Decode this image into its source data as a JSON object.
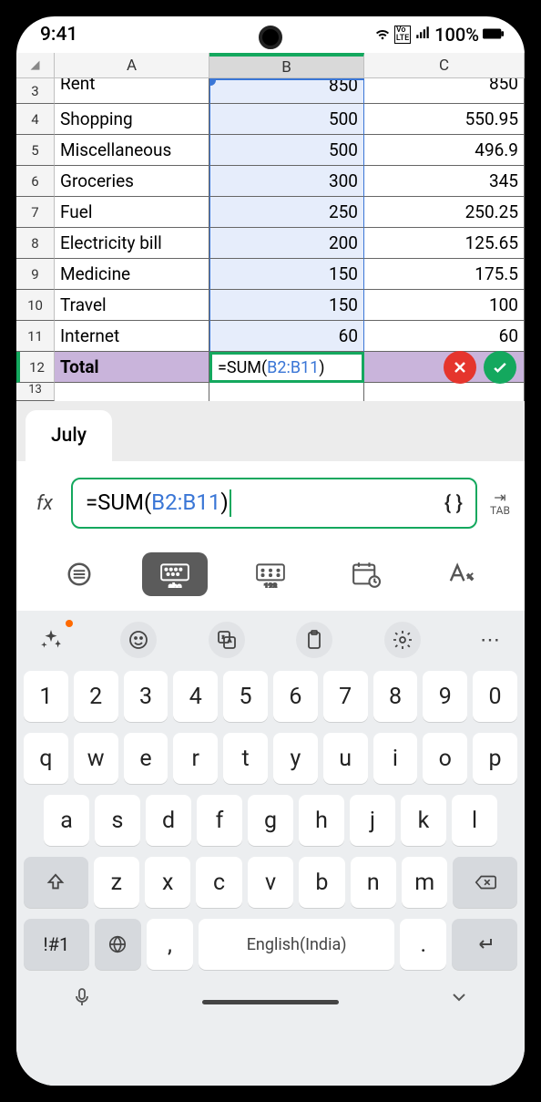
{
  "status": {
    "time": "9:41",
    "battery": "100%"
  },
  "columns": {
    "A": "A",
    "B": "B",
    "C": "C"
  },
  "rows": [
    {
      "n": "3",
      "a": "Rent",
      "b": "850",
      "c": "850"
    },
    {
      "n": "4",
      "a": "Shopping",
      "b": "500",
      "c": "550.95"
    },
    {
      "n": "5",
      "a": "Miscellaneous",
      "b": "500",
      "c": "496.9"
    },
    {
      "n": "6",
      "a": "Groceries",
      "b": "300",
      "c": "345"
    },
    {
      "n": "7",
      "a": "Fuel",
      "b": "250",
      "c": "250.25"
    },
    {
      "n": "8",
      "a": "Electricity bill",
      "b": "200",
      "c": "125.65"
    },
    {
      "n": "9",
      "a": "Medicine",
      "b": "150",
      "c": "175.5"
    },
    {
      "n": "10",
      "a": "Travel",
      "b": "150",
      "c": "100"
    },
    {
      "n": "11",
      "a": "Internet",
      "b": "60",
      "c": "60"
    }
  ],
  "totalRow": {
    "n": "12",
    "label": "Total",
    "formula_prefix": "=SUM(",
    "formula_ref": "B2:B11",
    "formula_suffix": ")"
  },
  "row13n": "13",
  "sheetTab": "July",
  "fx": {
    "label": "fx",
    "prefix": "=SUM(",
    "ref": "B2:B11",
    "suffix": ")",
    "braces": "{ }",
    "tab": "TAB"
  },
  "keyboard": {
    "r1": [
      "1",
      "2",
      "3",
      "4",
      "5",
      "6",
      "7",
      "8",
      "9",
      "0"
    ],
    "r2": [
      "q",
      "w",
      "e",
      "r",
      "t",
      "y",
      "u",
      "i",
      "o",
      "p"
    ],
    "r3": [
      "a",
      "s",
      "d",
      "f",
      "g",
      "h",
      "j",
      "k",
      "l"
    ],
    "r4": [
      "z",
      "x",
      "c",
      "v",
      "b",
      "n",
      "m"
    ],
    "sym": "!#1",
    "comma": ",",
    "period": ".",
    "space": "English(India)"
  }
}
